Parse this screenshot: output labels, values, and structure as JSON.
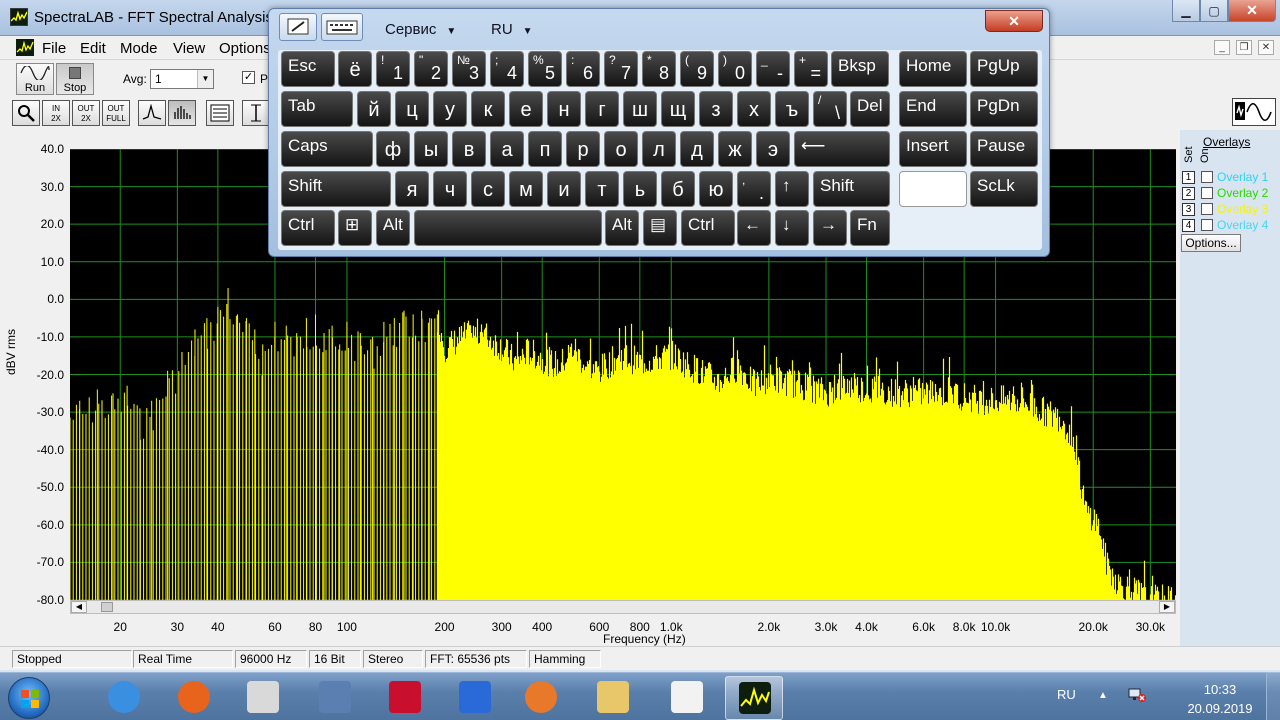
{
  "window": {
    "title": "SpectraLAB - FFT Spectral Analysis S",
    "min_label": "▁",
    "max_label": "▢",
    "close_label": "✕"
  },
  "menu": [
    "File",
    "Edit",
    "Mode",
    "View",
    "Options"
  ],
  "toolbar": {
    "run_label": "Run",
    "stop_label": "Stop",
    "avg_label": "Avg:",
    "avg_value": "1",
    "check_mark": "✓",
    "check_label": "P"
  },
  "toolbar2": {
    "zoom_in_1": "IN",
    "zoom_in_2": "2X",
    "zoom_out_1": "OUT",
    "zoom_out_2": "2X",
    "zoom_full_1": "OUT",
    "zoom_full_2": "FULL"
  },
  "plot": {
    "ylabel": "dBV rms",
    "xlabel": "Frequency (Hz)",
    "yticks": [
      "40.0",
      "30.0",
      "20.0",
      "10.0",
      "0.0",
      "-10.0",
      "-20.0",
      "-30.0",
      "-40.0",
      "-50.0",
      "-60.0",
      "-70.0",
      "-80.0"
    ],
    "xticks": [
      "20",
      "30",
      "40",
      "60",
      "80",
      "100",
      "200",
      "300",
      "400",
      "600",
      "800",
      "1.0k",
      "2.0k",
      "3.0k",
      "4.0k",
      "6.0k",
      "8.0k",
      "10.0k",
      "20.0k",
      "30.0k"
    ],
    "scroll_left": "◀",
    "scroll_right": "▶"
  },
  "chart_data": {
    "type": "bar",
    "title": "",
    "xlabel": "Frequency (Hz)",
    "ylabel": "dBV rms",
    "xscale": "log",
    "xlim": [
      14,
      36000
    ],
    "ylim": [
      -80,
      40
    ],
    "grid": true,
    "background": "#000000",
    "trace_color": "#ffff00",
    "series": [
      {
        "x": [
          15,
          17,
          19,
          21,
          23,
          25,
          28,
          31,
          34,
          37,
          40,
          43,
          46,
          49,
          52,
          55,
          60,
          65,
          70,
          75,
          80,
          85,
          90,
          95,
          100,
          110,
          120,
          130,
          140,
          150,
          160,
          170,
          180,
          190,
          200,
          230,
          260,
          300,
          330,
          360,
          400,
          450,
          500,
          550,
          600,
          700,
          800,
          900,
          1000,
          1200,
          1400,
          1600,
          1800,
          2000,
          2500,
          3000,
          3500,
          4000,
          5000,
          6000,
          7000,
          8000,
          9000,
          10000,
          12000,
          14000,
          16000,
          17000,
          18000,
          19000,
          20000,
          21000,
          22000,
          24000,
          27000,
          30000,
          33000
        ],
        "y": [
          -27,
          -24,
          -25,
          -23,
          -29,
          -27,
          -19,
          -14,
          -8,
          -5,
          -2,
          3,
          -4,
          -5,
          -8,
          -12,
          -6,
          -7,
          -9,
          -5,
          -4,
          -9,
          -7,
          -12,
          -6,
          -9,
          -10,
          -6,
          -5,
          -3,
          -4,
          -3,
          -5,
          -4,
          -12,
          -9,
          -8,
          -12,
          -16,
          -13,
          -15,
          -17,
          -12,
          -18,
          -18,
          -14,
          -16,
          -15,
          -14,
          -18,
          -21,
          -17,
          -22,
          -20,
          -22,
          -24,
          -22,
          -23,
          -24,
          -24,
          -24,
          -25,
          -26,
          -26,
          -26,
          -29,
          -31,
          -35,
          -45,
          -56,
          -57,
          -61,
          -70,
          -75,
          -77,
          -79,
          -79
        ]
      }
    ]
  },
  "overlays": {
    "title": "Overlays",
    "set_label": "Set",
    "on_label": "On",
    "items": [
      {
        "num": "1",
        "name": "Overlay 1",
        "color": "#2ad4f2"
      },
      {
        "num": "2",
        "name": "Overlay 2",
        "color": "#2ad800"
      },
      {
        "num": "3",
        "name": "Overlay 3",
        "color": "#f5f500"
      },
      {
        "num": "4",
        "name": "Overlay 4",
        "color": "#47d4f2"
      }
    ],
    "options_label": "Options..."
  },
  "status": [
    "Stopped",
    "Real Time",
    "96000 Hz",
    "16 Bit",
    "Stereo",
    "FFT: 65536 pts",
    "Hamming"
  ],
  "osk": {
    "menu_service": "Сервис",
    "menu_lang": "RU",
    "caret": "▼",
    "close": "✕",
    "keys": {
      "esc": "Esc",
      "yo": "ё",
      "n1": "1",
      "s1": "!",
      "n2": "2",
      "s2": "\"",
      "n3": "3",
      "s3": "№",
      "n4": "4",
      "s4": ";",
      "n5": "5",
      "s5": "%",
      "n6": "6",
      "s6": ":",
      "n7": "7",
      "s7": "?",
      "n8": "8",
      "s8": "*",
      "n9": "9",
      "s9": "(",
      "n0": "0",
      "s0": ")",
      "minus": "-",
      "sminus": "_",
      "eq": "=",
      "seq": "+",
      "bksp": "Bksp",
      "home": "Home",
      "pgup": "PgUp",
      "tab": "Tab",
      "r2": [
        "й",
        "ц",
        "у",
        "к",
        "е",
        "н",
        "г",
        "ш",
        "щ",
        "з",
        "х",
        "ъ"
      ],
      "bslash": "\\",
      "sbslash": "/",
      "del": "Del",
      "end": "End",
      "pgdn": "PgDn",
      "caps": "Caps",
      "r3": [
        "ф",
        "ы",
        "в",
        "а",
        "п",
        "р",
        "о",
        "л",
        "д",
        "ж",
        "э"
      ],
      "enter": "⟵",
      "insert": "Insert",
      "pause": "Pause",
      "shift": "Shift",
      "r4": [
        "я",
        "ч",
        "с",
        "м",
        "и",
        "т",
        "ь",
        "б",
        "ю"
      ],
      "dot": ".",
      "sdot": ",",
      "up": "↑",
      "sclk": "ScLk",
      "ctrl": "Ctrl",
      "win": "⊞",
      "alt": "Alt",
      "menu": "▤",
      "left": "←",
      "down": "↓",
      "right": "→",
      "fn": "Fn"
    }
  },
  "taskbar": {
    "lang": "RU",
    "tray_up": "▲",
    "time": "10:33",
    "date": "20.09.2019",
    "items": [
      {
        "name": "internet-explorer",
        "color": "#3b8fe0"
      },
      {
        "name": "firefox",
        "color": "#e8631c"
      },
      {
        "name": "signature-app",
        "color": "#d9d9d9"
      },
      {
        "name": "system-tool",
        "color": "#5b7fb0"
      },
      {
        "name": "save-disk",
        "color": "#c8102e"
      },
      {
        "name": "d-app",
        "color": "#2a6ad8"
      },
      {
        "name": "media-player",
        "color": "#e8782a"
      },
      {
        "name": "file-explorer",
        "color": "#e8c66a"
      },
      {
        "name": "alien-app",
        "color": "#f2f2f2"
      },
      {
        "name": "spectralab",
        "color": "#0e1e0e"
      }
    ]
  }
}
